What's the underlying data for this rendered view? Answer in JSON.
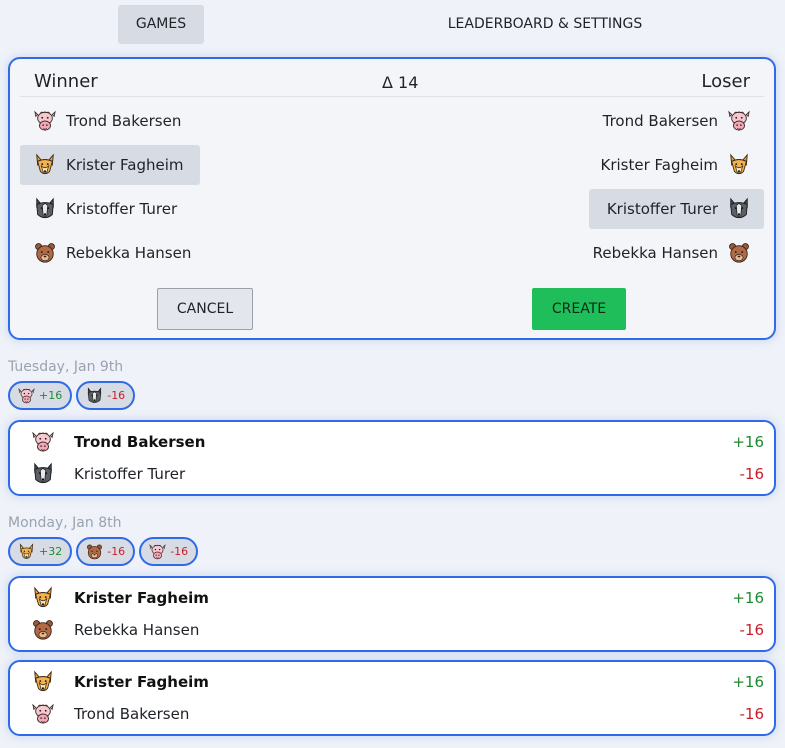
{
  "nav": {
    "games": "GAMES",
    "leaderboard": "LEADERBOARD & SETTINGS"
  },
  "create": {
    "winner_header": "Winner",
    "delta": "Δ 14",
    "loser_header": "Loser",
    "players": [
      {
        "name": "Trond Bakersen",
        "avatar": "cow-icon"
      },
      {
        "name": "Krister Fagheim",
        "avatar": "fox-icon"
      },
      {
        "name": "Kristoffer Turer",
        "avatar": "wolf-icon"
      },
      {
        "name": "Rebekka Hansen",
        "avatar": "bear-icon"
      }
    ],
    "selected_winner": "Krister Fagheim",
    "selected_loser": "Kristoffer Turer",
    "cancel_label": "CANCEL",
    "create_label": "CREATE"
  },
  "days": [
    {
      "date": "Tuesday, Jan 9th",
      "chips": [
        {
          "avatar": "cow-icon",
          "delta": "+16"
        },
        {
          "avatar": "wolf-icon",
          "delta": "-16"
        }
      ],
      "games": [
        {
          "winner": "Trond Bakersen",
          "winner_avatar": "cow-icon",
          "winner_delta": "+16",
          "loser": "Kristoffer Turer",
          "loser_avatar": "wolf-icon",
          "loser_delta": "-16"
        }
      ]
    },
    {
      "date": "Monday, Jan 8th",
      "chips": [
        {
          "avatar": "fox-icon",
          "delta": "+32"
        },
        {
          "avatar": "bear-icon",
          "delta": "-16"
        },
        {
          "avatar": "cow-icon",
          "delta": "-16"
        }
      ],
      "games": [
        {
          "winner": "Krister Fagheim",
          "winner_avatar": "fox-icon",
          "winner_delta": "+16",
          "loser": "Rebekka Hansen",
          "loser_avatar": "bear-icon",
          "loser_delta": "-16"
        },
        {
          "winner": "Krister Fagheim",
          "winner_avatar": "fox-icon",
          "winner_delta": "+16",
          "loser": "Trond Bakersen",
          "loser_avatar": "cow-icon",
          "loser_delta": "-16"
        }
      ]
    }
  ],
  "colors": {
    "accent": "#2f6be8",
    "create": "#1fbe5a",
    "positive": "#1e8a32",
    "negative": "#c8202a"
  }
}
